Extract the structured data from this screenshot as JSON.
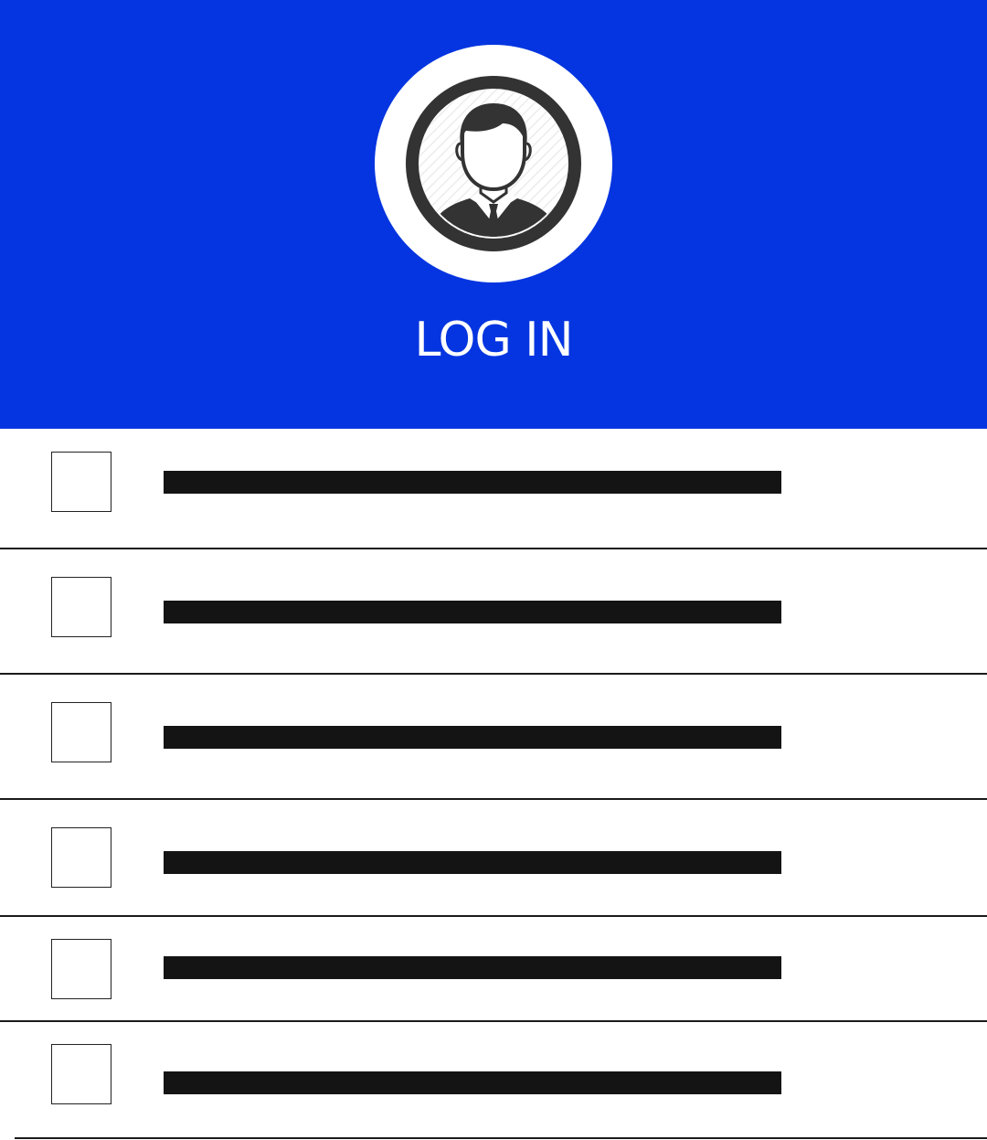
{
  "header": {
    "background_color": "#0435e0",
    "avatar_icon": "user-avatar-icon",
    "title": "LOG IN"
  },
  "form": {
    "rows": [
      {
        "checkbox_checked": false,
        "field_value": ""
      },
      {
        "checkbox_checked": false,
        "field_value": ""
      },
      {
        "checkbox_checked": false,
        "field_value": ""
      },
      {
        "checkbox_checked": false,
        "field_value": ""
      },
      {
        "checkbox_checked": false,
        "field_value": ""
      },
      {
        "checkbox_checked": false,
        "field_value": ""
      }
    ]
  }
}
